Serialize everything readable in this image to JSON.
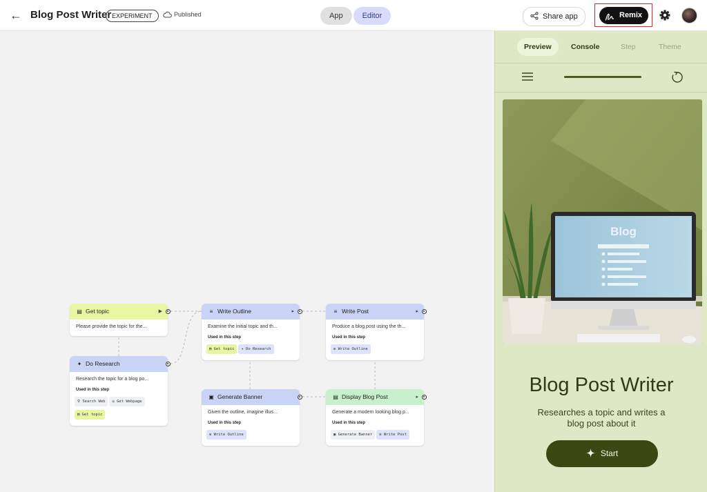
{
  "header": {
    "title": "Blog Post Writer",
    "badge": "EXPERIMENT",
    "status": "Published",
    "mode_app": "App",
    "mode_editor": "Editor",
    "share_label": "Share app",
    "remix_label": "Remix"
  },
  "nodes": {
    "get_topic": {
      "title": "Get topic",
      "desc": "Please provide the topic for the..."
    },
    "do_research": {
      "title": "Do Research",
      "desc": "Research the topic for a blog po...",
      "used_label": "Used in this step",
      "chips": [
        "Search Web",
        "Get Webpage",
        "Get topic"
      ]
    },
    "write_outline": {
      "title": "Write Outline",
      "desc": "Examine the initial topic and th...",
      "used_label": "Used in this step",
      "chips": [
        "Get topic",
        "Do Research"
      ]
    },
    "write_post": {
      "title": "Write Post",
      "desc": "Produce a blog post using the th...",
      "used_label": "Used in this step",
      "chips": [
        "Write Outline"
      ]
    },
    "generate_banner": {
      "title": "Generate Banner",
      "desc": "Given the outline, imagine illus...",
      "used_label": "Used in this step",
      "chips": [
        "Write Outline"
      ]
    },
    "display_blog_post": {
      "title": "Display Blog Post",
      "desc": "Generate a modern looking blog p...",
      "used_label": "Used in this step",
      "chips": [
        "Generate Banner",
        "Write Post"
      ]
    }
  },
  "panel": {
    "tabs": [
      "Preview",
      "Console",
      "Step",
      "Theme"
    ],
    "hero_text": "Blog",
    "app_title": "Blog Post Writer",
    "app_subtitle": "Researches a topic and writes a blog post about it",
    "start_label": "Start"
  },
  "colors": {
    "remix_highlight": "#e22828",
    "panel_bg": "#dfe8c4",
    "start_button": "#3d4713",
    "node_input_header": "#e8f6a2",
    "node_step_header": "#c9d3f5",
    "node_output_header": "#c9f0cc"
  },
  "icons": {
    "back": "arrow-left-icon",
    "published": "cloud-icon",
    "share": "share-icon",
    "remix": "remix-icon",
    "settings": "gear-icon",
    "menu": "hamburger-icon",
    "reload": "reload-icon",
    "start": "sparkle-icon"
  }
}
